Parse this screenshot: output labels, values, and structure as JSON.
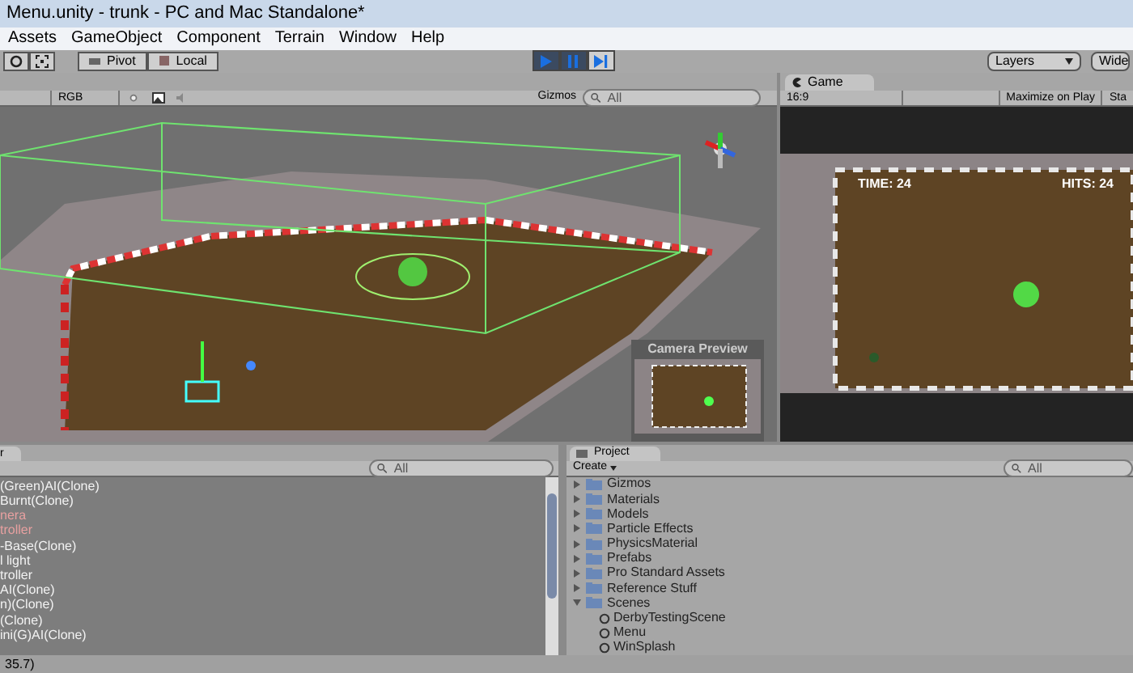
{
  "window": {
    "title": "Menu.unity - trunk - PC and Mac Standalone*"
  },
  "menu": [
    "Assets",
    "GameObject",
    "Component",
    "Terrain",
    "Window",
    "Help"
  ],
  "toolbar": {
    "pivot": "Pivot",
    "local": "Local",
    "layers": "Layers",
    "layout": "Wide",
    "playback": [
      {
        "kind": "play",
        "selected": true
      },
      {
        "kind": "pause",
        "selected": true
      },
      {
        "kind": "step",
        "selected": false
      }
    ]
  },
  "scene": {
    "render_mode": "RGB",
    "gizmos": "Gizmos",
    "search": {
      "placeholder": "All"
    },
    "camera_preview": {
      "title": "Camera Preview"
    }
  },
  "game": {
    "tab": "Game",
    "aspect": "16:9",
    "maximize": "Maximize on Play",
    "stats": "Sta",
    "hud": [
      "TIME: 24",
      "HITS: 24"
    ]
  },
  "hierarchy": {
    "tab": "r",
    "search": {
      "placeholder": "All"
    },
    "items": [
      {
        "label": "(Green)AI(Clone)",
        "kind": "object"
      },
      {
        "label": "Burnt(Clone)",
        "kind": "object"
      },
      {
        "label": "nera",
        "kind": "missing"
      },
      {
        "label": "troller",
        "kind": "missing"
      },
      {
        "label": "-Base(Clone)",
        "kind": "object"
      },
      {
        "label": "l light",
        "kind": "object"
      },
      {
        "label": "troller",
        "kind": "object"
      },
      {
        "label": "AI(Clone)",
        "kind": "object"
      },
      {
        "label": "n)(Clone)",
        "kind": "object"
      },
      {
        "label": "(Clone)",
        "kind": "object"
      },
      {
        "label": "ini(G)AI(Clone)",
        "kind": "object"
      }
    ]
  },
  "project": {
    "tab": "Project",
    "create": "Create",
    "search": {
      "placeholder": "All"
    },
    "items": [
      {
        "label": "Gizmos",
        "expanded": false
      },
      {
        "label": "Materials",
        "expanded": false
      },
      {
        "label": "Models",
        "expanded": false
      },
      {
        "label": "Particle Effects",
        "expanded": false
      },
      {
        "label": "PhysicsMaterial",
        "expanded": false
      },
      {
        "label": "Prefabs",
        "expanded": false
      },
      {
        "label": "Pro Standard Assets",
        "expanded": false
      },
      {
        "label": "Reference Stuff",
        "expanded": false
      },
      {
        "label": "Scenes",
        "expanded": true,
        "children": [
          {
            "label": "DerbyTestingScene"
          },
          {
            "label": "Menu"
          },
          {
            "label": "WinSplash"
          }
        ]
      }
    ]
  },
  "status_bar": {
    "text": "35.7)"
  }
}
